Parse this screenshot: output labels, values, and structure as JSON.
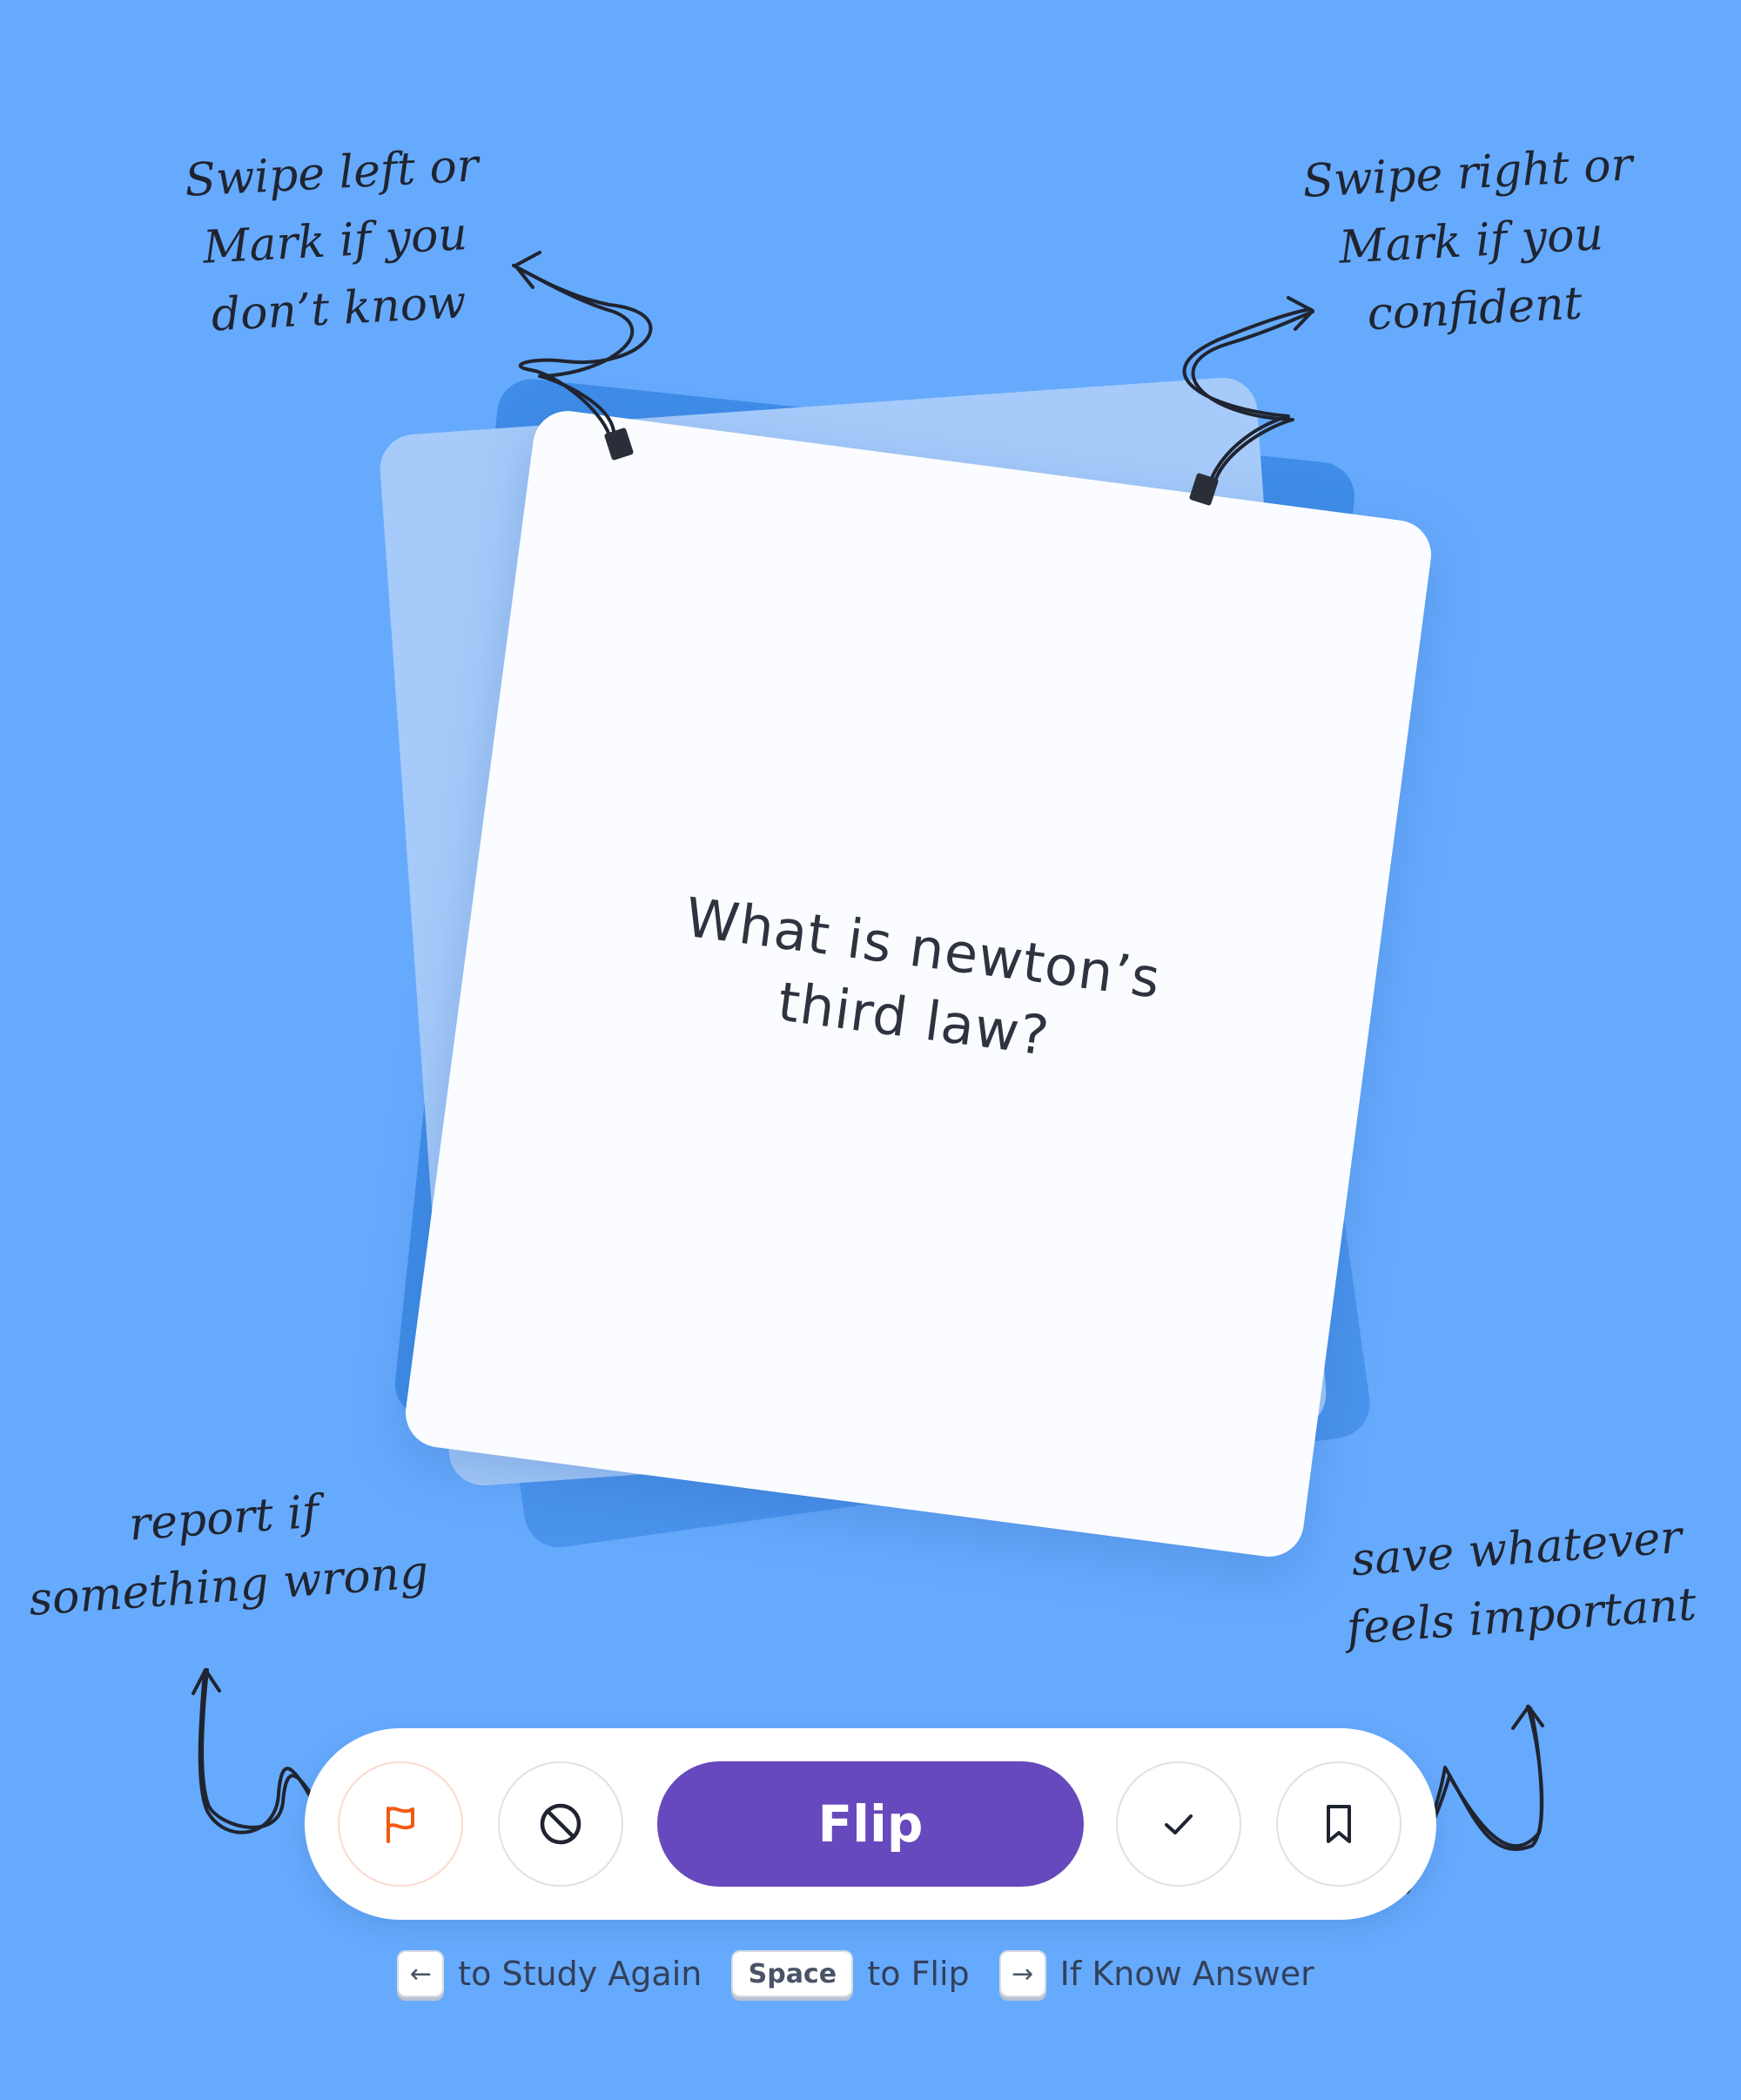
{
  "card": {
    "question": "What is newton’s third law?"
  },
  "annotations": {
    "left_swipe": [
      "Swipe left or",
      "Mark if you",
      "don’t know"
    ],
    "right_swipe": [
      "Swipe right or",
      "Mark if you",
      "confident"
    ],
    "report": [
      "report if",
      "something wrong"
    ],
    "save": [
      "save whatever",
      "feels important"
    ]
  },
  "actions": {
    "flip_label": "Flip",
    "report_icon": "flag-icon",
    "skip_icon": "block-icon",
    "know_icon": "check-icon",
    "save_icon": "bookmark-icon"
  },
  "hints": {
    "left_key": "←",
    "left_text": "to Study Again",
    "space_key": "Space",
    "space_text": "to Flip",
    "right_key": "→",
    "right_text": "If Know Answer"
  },
  "colors": {
    "background": "#66aafd",
    "flip_button": "#6649bd",
    "report_flag": "#f25a12",
    "card": "#fbfcff"
  }
}
